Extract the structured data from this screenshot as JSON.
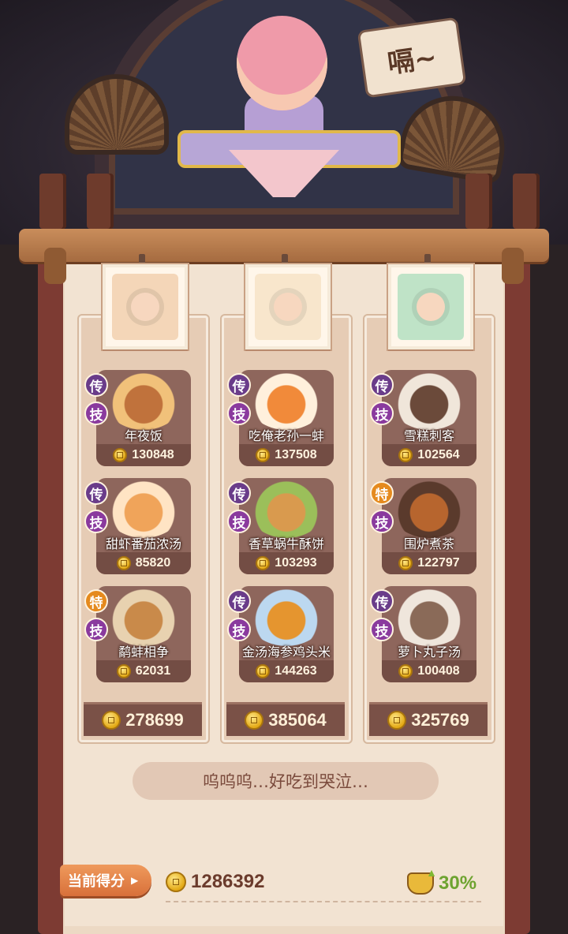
{
  "speech_bubble": "嗝~",
  "columns": [
    {
      "dishes": [
        {
          "name": "年夜饭",
          "price": "130848",
          "badges": [
            "传",
            "技"
          ],
          "colors": [
            "#c0723c",
            "#f1c17a"
          ]
        },
        {
          "name": "甜虾番茄浓汤",
          "price": "85820",
          "badges": [
            "传",
            "技"
          ],
          "colors": [
            "#f0a45a",
            "#ffe4c4"
          ]
        },
        {
          "name": "鹬蚌相争",
          "price": "62031",
          "badges": [
            "特",
            "技"
          ],
          "colors": [
            "#c98a4a",
            "#e8d2b0"
          ]
        }
      ],
      "total": "278699"
    },
    {
      "dishes": [
        {
          "name": "吃俺老孙一蚌",
          "price": "137508",
          "badges": [
            "传",
            "技"
          ],
          "colors": [
            "#f18a3a",
            "#fff0dc"
          ]
        },
        {
          "name": "香草蜗牛酥饼",
          "price": "103293",
          "badges": [
            "传",
            "技"
          ],
          "colors": [
            "#d99a4e",
            "#9bbf5a"
          ]
        },
        {
          "name": "金汤海参鸡头米",
          "price": "144263",
          "badges": [
            "传",
            "技"
          ],
          "colors": [
            "#e5952f",
            "#bcd8f0"
          ]
        }
      ],
      "total": "385064"
    },
    {
      "dishes": [
        {
          "name": "雪糕刺客",
          "price": "102564",
          "badges": [
            "传",
            "技"
          ],
          "colors": [
            "#6b4a3a",
            "#f0e6da"
          ]
        },
        {
          "name": "围炉煮茶",
          "price": "122797",
          "badges": [
            "特",
            "技"
          ],
          "colors": [
            "#b7652e",
            "#5a3a2c"
          ]
        },
        {
          "name": "萝卜丸子汤",
          "price": "100408",
          "badges": [
            "传",
            "技"
          ],
          "colors": [
            "#8a6a58",
            "#efe6dc"
          ]
        }
      ],
      "total": "325769"
    }
  ],
  "portrait_colors": [
    "#f4d6b8",
    "#f8e6cc",
    "#bfe3c7"
  ],
  "comment": "呜呜呜…好吃到哭泣…",
  "score_label": "当前得分",
  "score_value": "1286392",
  "bonus_percent": "30%",
  "badge_colors": {
    "传": "#6a3c8a",
    "特": "#e58a1e",
    "技": "#8a3a9e"
  }
}
